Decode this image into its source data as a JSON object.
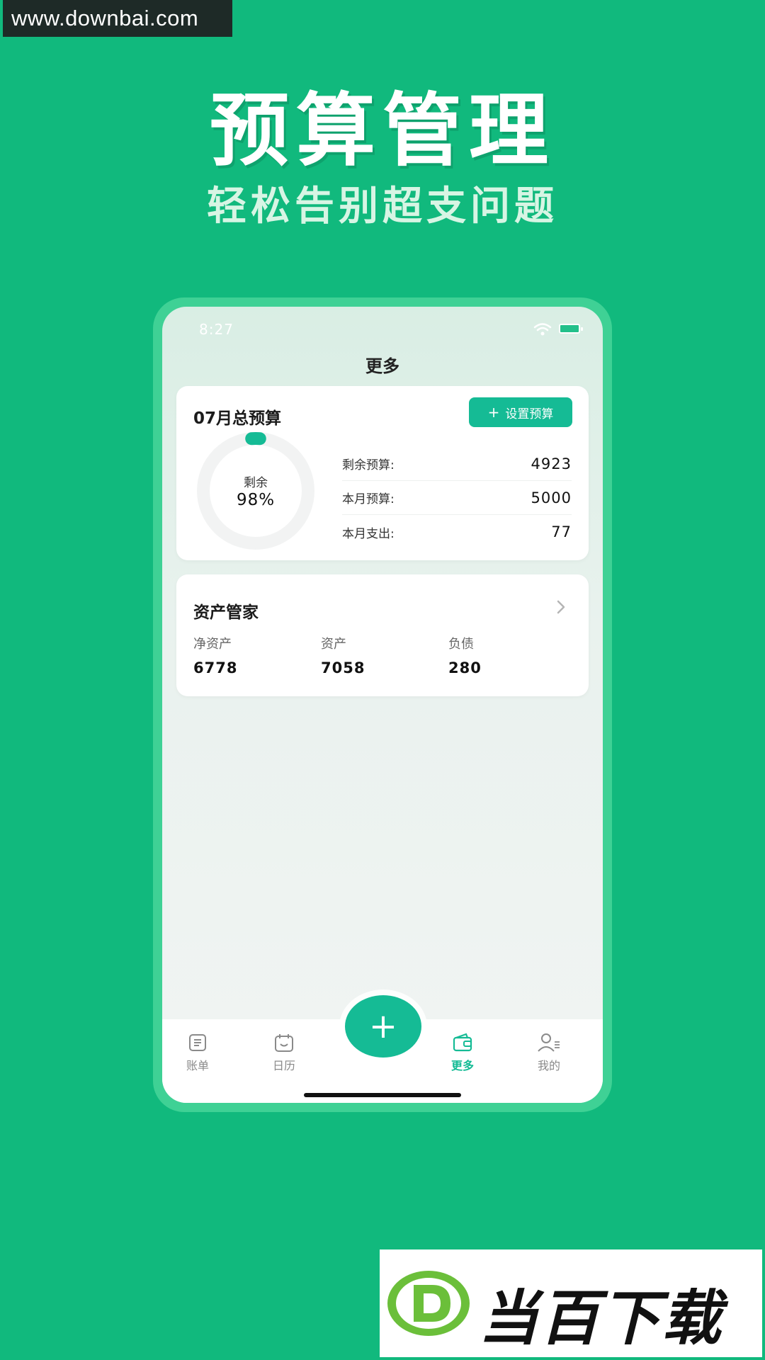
{
  "watermark_top": "www.downbai.com",
  "promo": {
    "title": "预算管理",
    "subtitle": "轻松告别超支问题"
  },
  "status_bar": {
    "time": "8:27"
  },
  "nav": {
    "title": "更多"
  },
  "budget_card": {
    "title": "07月总预算",
    "set_button_label": "设置预算",
    "ring_label": "剩余",
    "ring_value": "98%",
    "remaining_fraction": 0.98,
    "rows": [
      {
        "label": "剩余预算:",
        "value": "4923"
      },
      {
        "label": "本月预算:",
        "value": "5000"
      },
      {
        "label": "本月支出:",
        "value": "77"
      }
    ]
  },
  "asset_card": {
    "title": "资产管家",
    "columns": [
      {
        "label": "净资产",
        "value": "6778"
      },
      {
        "label": "资产",
        "value": "7058"
      },
      {
        "label": "负债",
        "value": "280"
      }
    ]
  },
  "tab_bar": {
    "tabs": [
      {
        "label": "账单",
        "icon": "bill-icon"
      },
      {
        "label": "日历",
        "icon": "calendar-icon"
      },
      {
        "label": "更多",
        "icon": "wallet-icon"
      },
      {
        "label": "我的",
        "icon": "user-icon"
      }
    ],
    "fab": "+"
  },
  "watermark_bottom": "当百下载",
  "colors": {
    "background": "#11b97d",
    "accent": "#15bb95",
    "frame": "#3fd195"
  }
}
